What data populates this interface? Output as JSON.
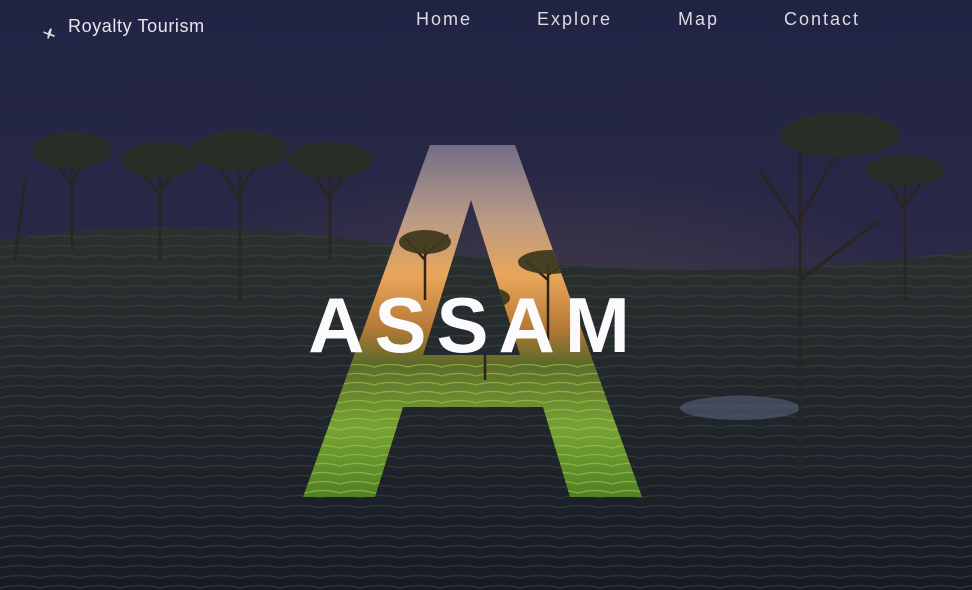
{
  "brand": {
    "name": "Royalty Tourism",
    "icon": "plane-icon"
  },
  "nav": {
    "items": [
      "Home",
      "Explore",
      "Map",
      "Contact"
    ]
  },
  "hero": {
    "title": "ASSAM"
  },
  "colors": {
    "overlay": "#1c1f3a",
    "sky_glow": "#f1b15a",
    "tea_green": "#5f8f2f",
    "text": "#ffffff"
  }
}
